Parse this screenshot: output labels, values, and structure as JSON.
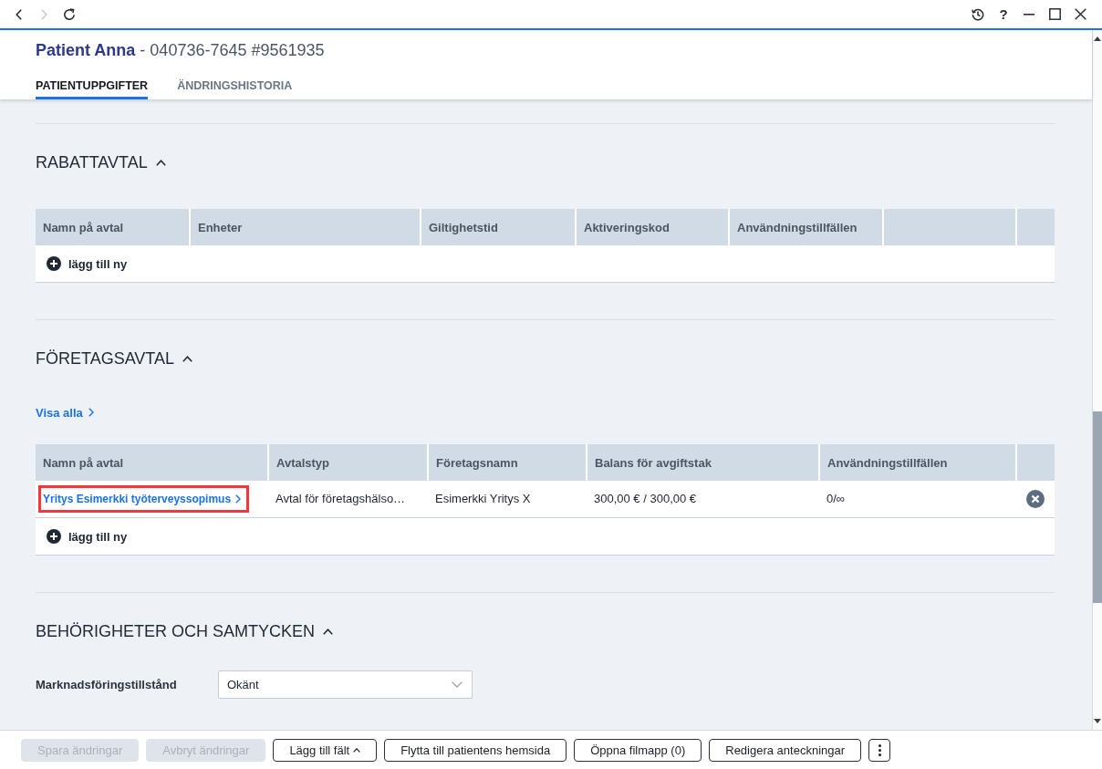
{
  "browser_nav": [
    {
      "kind": "back",
      "disabled": false
    },
    {
      "kind": "forward",
      "disabled": true
    },
    {
      "kind": "reload",
      "disabled": false
    }
  ],
  "window_controls": [
    {
      "kind": "history"
    },
    {
      "kind": "help",
      "label": "?"
    },
    {
      "kind": "minimize"
    },
    {
      "kind": "maximize"
    },
    {
      "kind": "close"
    }
  ],
  "patient": {
    "name": "Patient Anna",
    "details": "- 040736-7645 #9561935"
  },
  "tabs": [
    {
      "label": "PATIENTUPPGIFTER",
      "selected": true
    },
    {
      "label": "ÄNDRINGSHISTORIA",
      "selected": false
    }
  ],
  "sections": [
    {
      "kind": "table",
      "title": "RABATTAVTAL",
      "expanded": true,
      "columns": [
        "Namn på avtal",
        "Enheter",
        "Giltighetstid",
        "Aktiveringskod",
        "Användningstillfällen"
      ],
      "add_label": "lägg till ny"
    },
    {
      "kind": "table",
      "title": "FÖRETAGSAVTAL",
      "expanded": true,
      "view_all": "Visa alla",
      "columns": [
        "Namn på avtal",
        "Avtalstyp",
        "Företagsnamn",
        "Balans för avgiftstak",
        "Användningstillfällen"
      ],
      "rows": [
        {
          "highlighted": true,
          "cells": [
            "Yritys Esimerkki työterveyssopimus",
            "Avtal för företagshälso…",
            "Esimerkki Yritys X",
            "300,00 € / 300,00 €",
            "0/∞"
          ]
        }
      ],
      "add_label": "lägg till ny"
    },
    {
      "kind": "fields",
      "title": "BEHÖRIGHETER OCH SAMTYCKEN",
      "expanded": true,
      "fields": [
        {
          "label": "Marknadsföringstillstånd",
          "value": "Okänt"
        }
      ]
    }
  ],
  "footer_buttons": [
    {
      "kind": "text",
      "label": "Spara ändringar",
      "disabled": true
    },
    {
      "kind": "text",
      "label": "Avbryt ändringar",
      "disabled": true
    },
    {
      "kind": "menu",
      "label": "Lägg till fält",
      "disabled": false
    },
    {
      "kind": "text",
      "label": "Flytta till patientens hemsida",
      "disabled": false
    },
    {
      "kind": "text",
      "label": "Öppna filmapp (0)",
      "disabled": false
    },
    {
      "kind": "text",
      "label": "Redigera anteckningar",
      "disabled": false
    },
    {
      "kind": "more",
      "disabled": false
    }
  ]
}
